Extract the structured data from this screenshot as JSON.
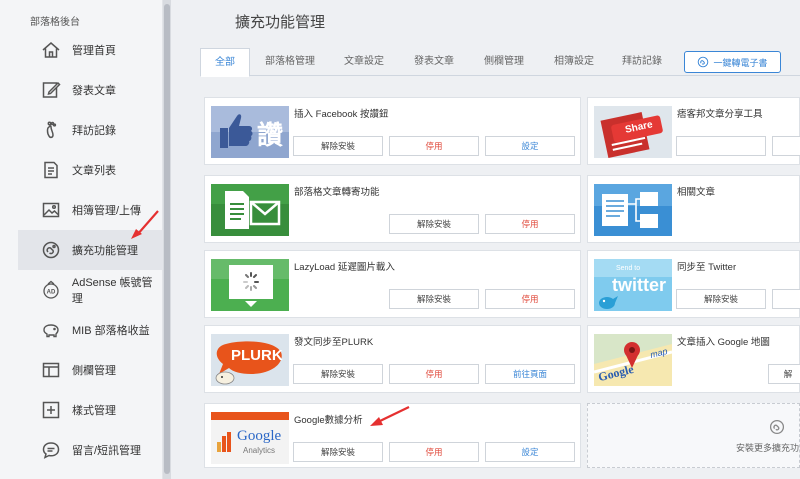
{
  "sidebar": {
    "title": "部落格後台",
    "items": [
      {
        "label": "管理首頁",
        "icon": "home-icon"
      },
      {
        "label": "發表文章",
        "icon": "edit-icon"
      },
      {
        "label": "拜訪記錄",
        "icon": "footprint-icon"
      },
      {
        "label": "文章列表",
        "icon": "document-icon"
      },
      {
        "label": "相簿管理/上傳",
        "icon": "image-icon"
      },
      {
        "label": "擴充功能管理",
        "icon": "extension-icon"
      },
      {
        "label": "AdSense 帳號管理",
        "icon": "adsense-icon"
      },
      {
        "label": "MIB 部落格收益",
        "icon": "piggy-bank-icon"
      },
      {
        "label": "側欄管理",
        "icon": "sidebar-layout-icon"
      },
      {
        "label": "樣式管理",
        "icon": "plus-box-icon"
      },
      {
        "label": "留言/短訊管理",
        "icon": "chat-icon"
      }
    ]
  },
  "page": {
    "title": "擴充功能管理"
  },
  "tabs": [
    "全部",
    "部落格管理",
    "文章設定",
    "發表文章",
    "側欄管理",
    "相簿設定",
    "拜訪記錄"
  ],
  "ebook_button": "一鍵轉電子書",
  "cards": {
    "facebook": {
      "title": "插入 Facebook 按讚鈕",
      "thumb_text": "讚",
      "b1": "解除安裝",
      "b2": "停用",
      "b3": "設定"
    },
    "share": {
      "title": "痞客邦文章分享工具",
      "thumb_text": "Share"
    },
    "mail": {
      "title": "部落格文章轉寄功能",
      "b1": "解除安裝",
      "b2": "停用"
    },
    "related": {
      "title": "相關文章"
    },
    "lazyload": {
      "title": "LazyLoad 延遲圖片載入",
      "b1": "解除安裝",
      "b2": "停用"
    },
    "twitter": {
      "title": "同步至 Twitter",
      "thumb_text": "twitter",
      "thumb_sub": "Send to",
      "b1": "解除安裝"
    },
    "plurk": {
      "title": "發文同步至PLURK",
      "thumb_text": "PLURK",
      "b1": "解除安裝",
      "b2": "停用",
      "b3": "前往頁面"
    },
    "gmap": {
      "title": "文章插入 Google 地圖",
      "thumb_text": "Google",
      "thumb_sub": "map",
      "b1": "解"
    },
    "analytics": {
      "title": "Google數據分析",
      "thumb_text": "Google",
      "thumb_sub": "Analytics",
      "b1": "解除安裝",
      "b2": "停用",
      "b3": "設定"
    }
  },
  "install_more": "安裝更多擴充功",
  "colors": {
    "accent": "#3a86d6",
    "danger": "#e0483a",
    "arrow": "#e53030"
  }
}
